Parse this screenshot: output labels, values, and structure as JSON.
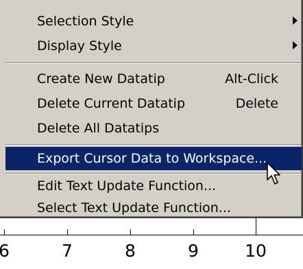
{
  "menu": {
    "items": [
      {
        "label": "Selection Style",
        "submenu": true
      },
      {
        "label": "Display Style",
        "submenu": true
      },
      {
        "label": "Create New Datatip",
        "shortcut": "Alt-Click"
      },
      {
        "label": "Delete Current Datatip",
        "shortcut": "Delete"
      },
      {
        "label": "Delete All Datatips"
      },
      {
        "label": "Export Cursor Data to Workspace...",
        "selected": true
      },
      {
        "label": "Edit Text Update Function..."
      },
      {
        "label": "Select Text Update Function..."
      }
    ]
  },
  "axis": {
    "tick_labels": [
      "6",
      "7",
      "8",
      "9",
      "10"
    ]
  },
  "colors": {
    "menu_background": "#d4d0c8",
    "highlight": "#0a246a",
    "highlight_text": "#ffffff"
  },
  "icons": {
    "submenu": "chevron-right-icon",
    "pointer": "mouse-pointer-icon"
  }
}
